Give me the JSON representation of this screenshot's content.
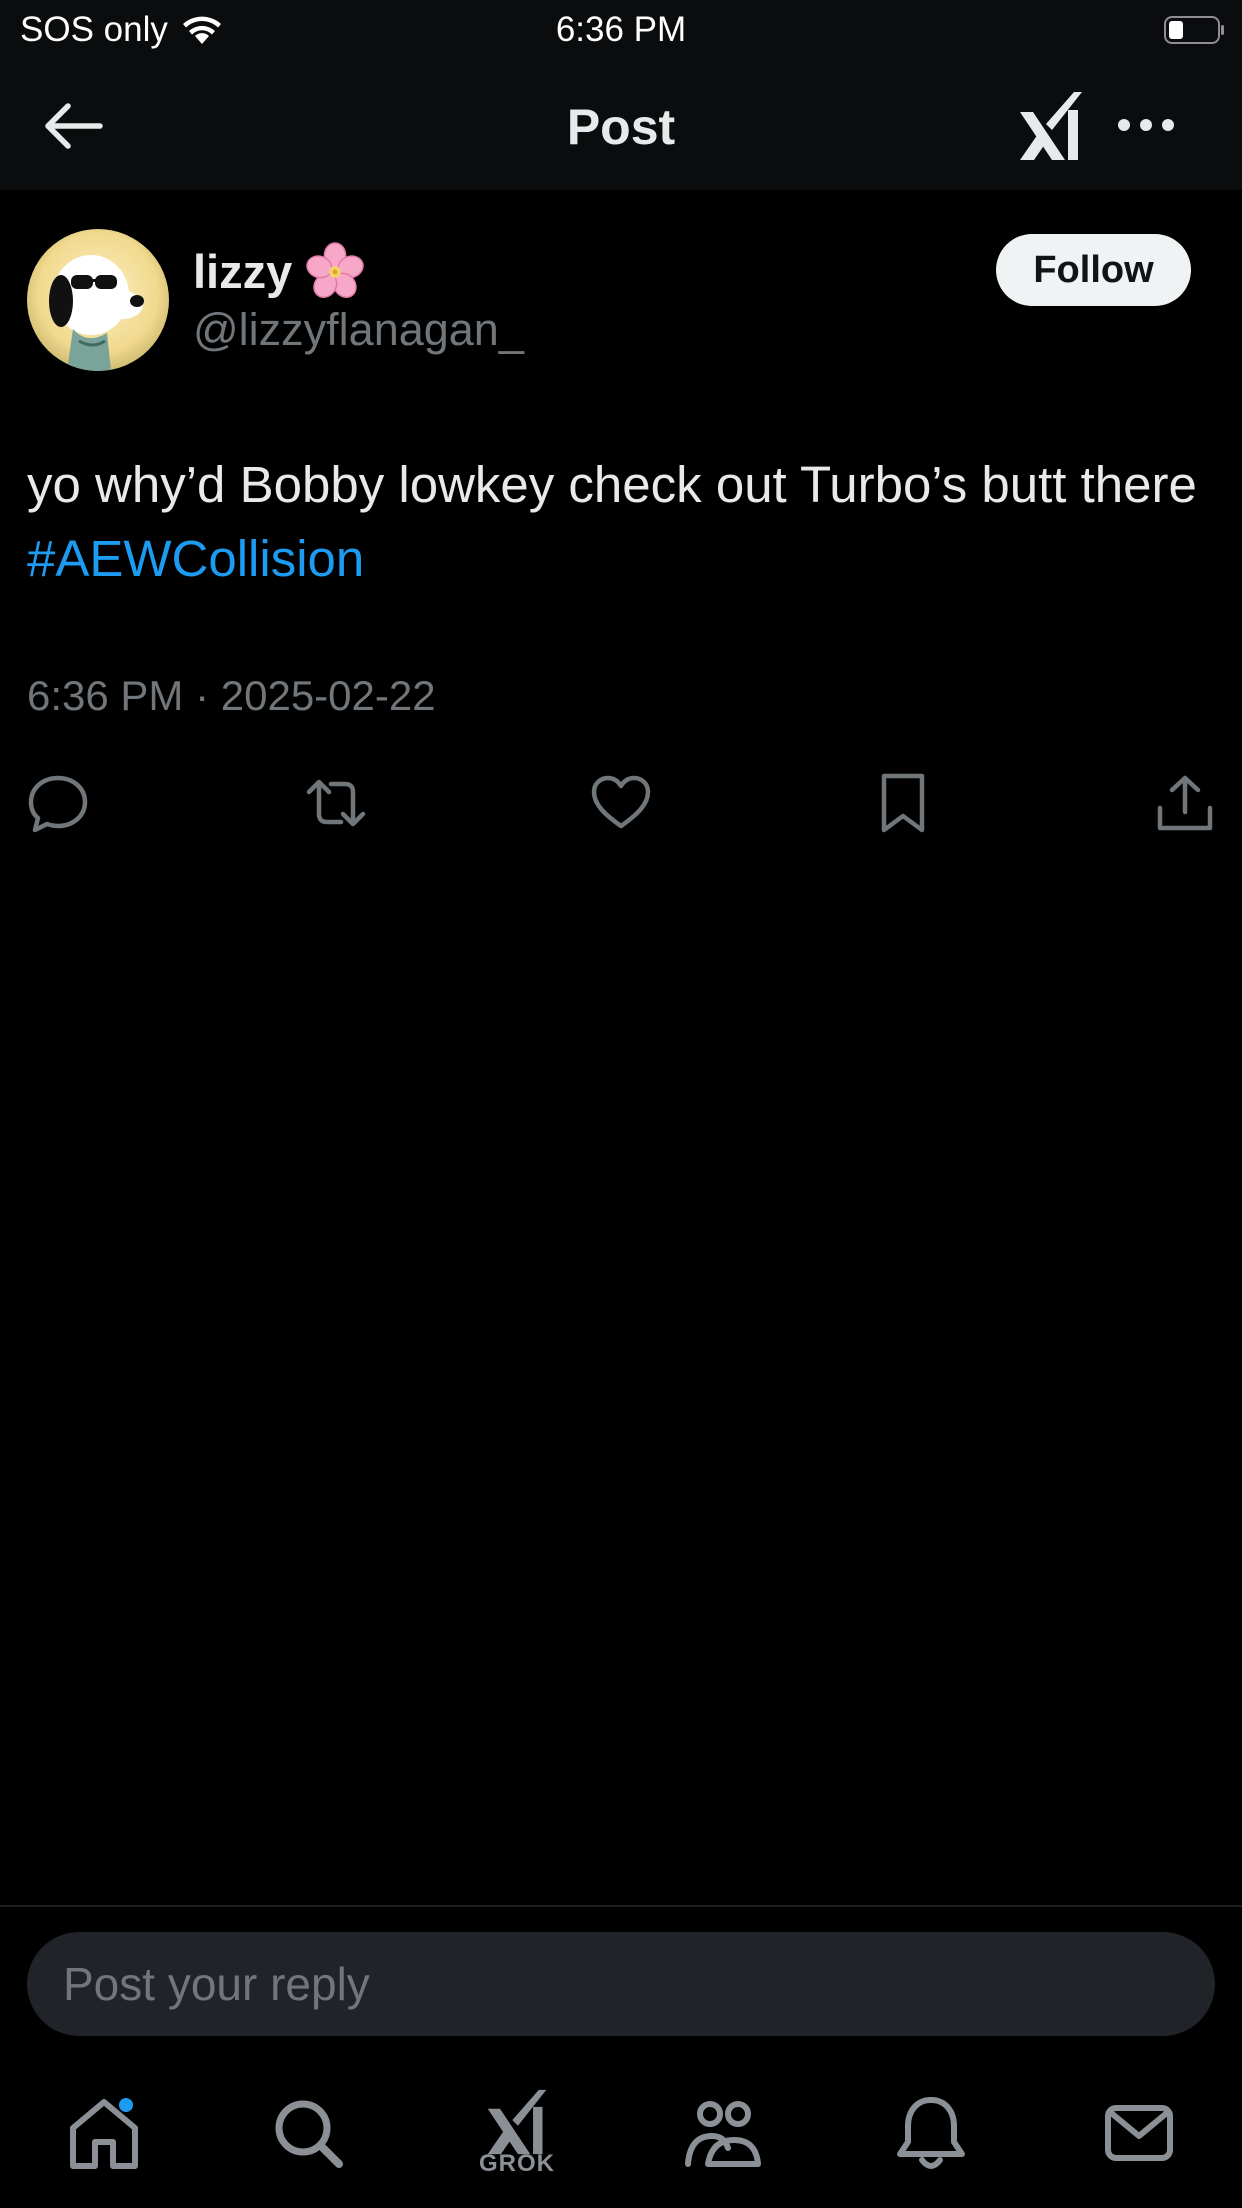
{
  "status_bar": {
    "carrier": "SOS only",
    "time": "6:36 PM",
    "icons": [
      "wifi-icon",
      "battery-icon"
    ]
  },
  "nav": {
    "title": "Post",
    "icons": [
      "back-arrow-icon",
      "grok-icon",
      "more-options-icon"
    ]
  },
  "post": {
    "display_name": "lizzy",
    "name_emoji": "cherry-blossom-icon",
    "handle": "@lizzyflanagan_",
    "follow_label": "Follow",
    "text": "yo why’d Bobby lowkey check out Turbo’s butt there ",
    "hashtag": "#AEWCollision",
    "timestamp": "6:36 PM · 2025-02-22",
    "actions": [
      "reply-icon",
      "repost-icon",
      "like-icon",
      "bookmark-icon",
      "share-icon"
    ]
  },
  "reply": {
    "placeholder": "Post your reply"
  },
  "tab_bar": {
    "grok_label": "GROK",
    "tabs": [
      "home-icon",
      "search-icon",
      "grok-icon",
      "communities-icon",
      "notifications-icon",
      "messages-icon"
    ]
  },
  "colors": {
    "background": "#000000",
    "accent": "#1d9bf0",
    "text_primary": "#e7e9ea",
    "text_secondary": "#71767b",
    "input_bg": "#202327"
  }
}
